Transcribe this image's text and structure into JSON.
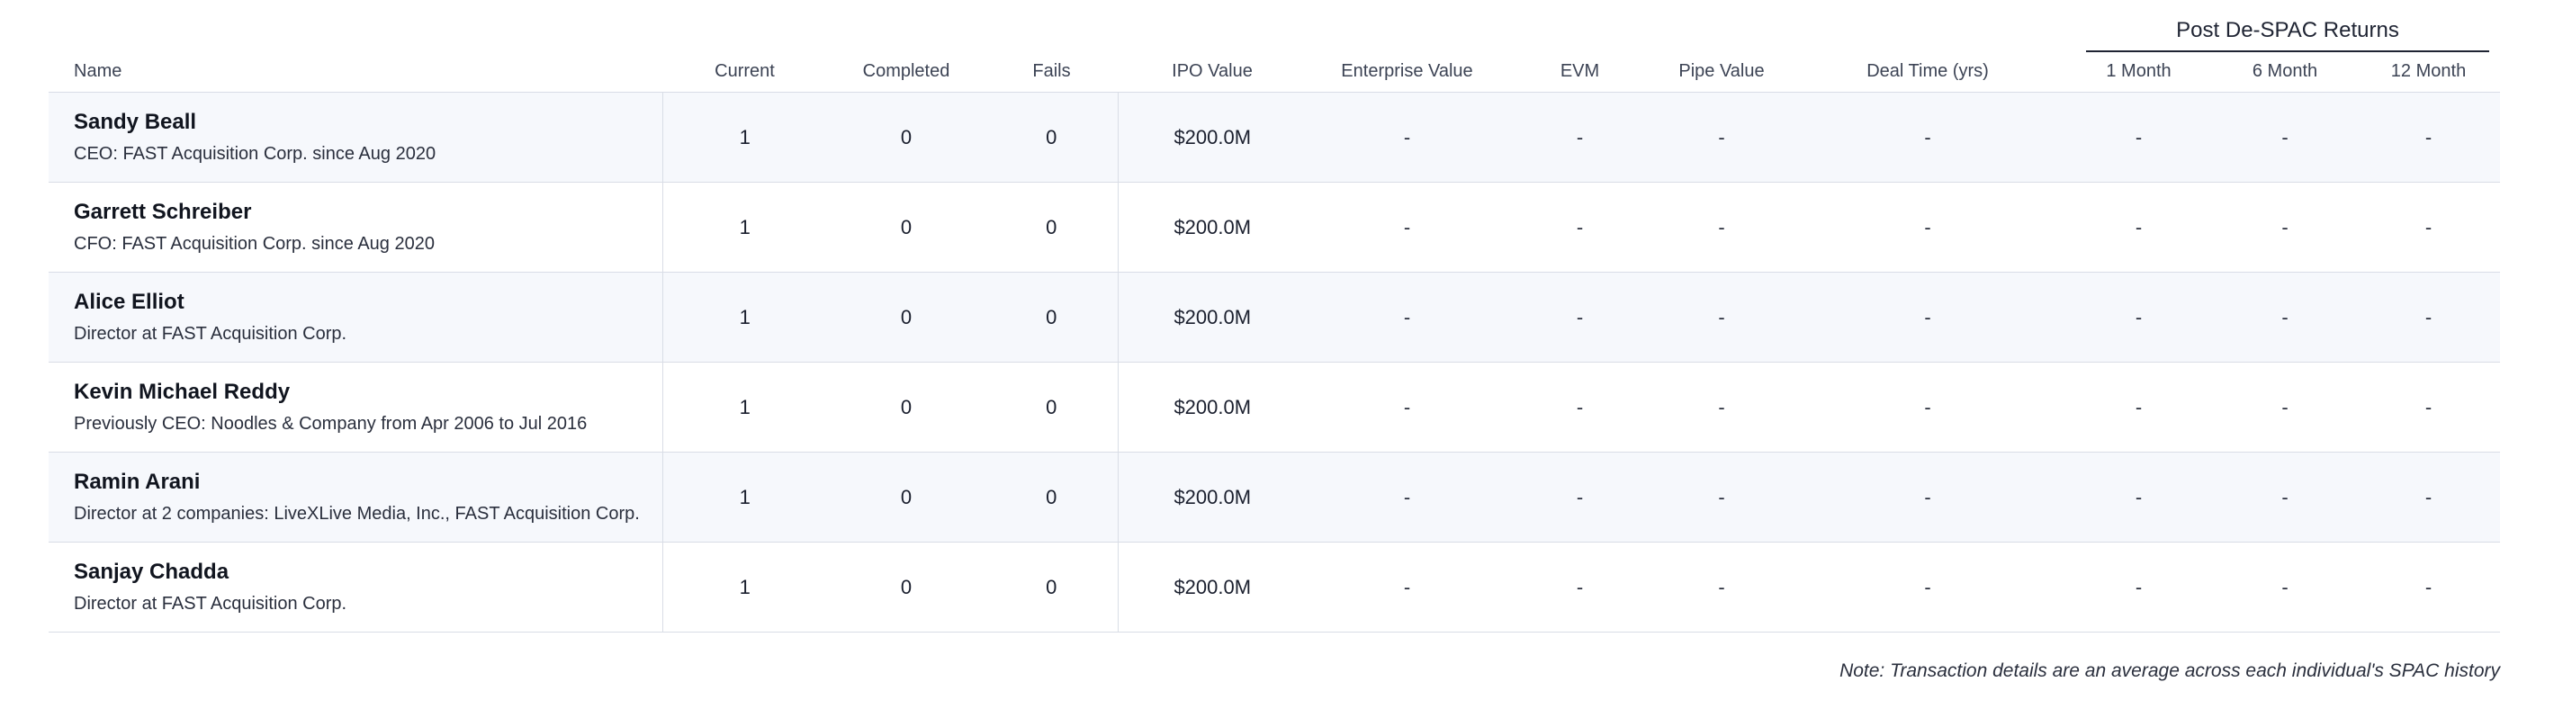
{
  "group_header": "Post De-SPAC Returns",
  "columns": {
    "name": "Name",
    "current": "Current",
    "completed": "Completed",
    "fails": "Fails",
    "ipo_value": "IPO Value",
    "enterprise_value": "Enterprise Value",
    "evm": "EVM",
    "pipe_value": "Pipe Value",
    "deal_time": "Deal Time (yrs)",
    "m1": "1 Month",
    "m6": "6 Month",
    "m12": "12 Month"
  },
  "rows": [
    {
      "name": "Sandy Beall",
      "title": "CEO: FAST Acquisition Corp. since Aug 2020",
      "current": "1",
      "completed": "0",
      "fails": "0",
      "ipo_value": "$200.0M",
      "enterprise_value": "-",
      "evm": "-",
      "pipe_value": "-",
      "deal_time": "-",
      "m1": "-",
      "m6": "-",
      "m12": "-"
    },
    {
      "name": "Garrett Schreiber",
      "title": "CFO: FAST Acquisition Corp. since Aug 2020",
      "current": "1",
      "completed": "0",
      "fails": "0",
      "ipo_value": "$200.0M",
      "enterprise_value": "-",
      "evm": "-",
      "pipe_value": "-",
      "deal_time": "-",
      "m1": "-",
      "m6": "-",
      "m12": "-"
    },
    {
      "name": "Alice Elliot",
      "title": "Director at FAST Acquisition Corp.",
      "current": "1",
      "completed": "0",
      "fails": "0",
      "ipo_value": "$200.0M",
      "enterprise_value": "-",
      "evm": "-",
      "pipe_value": "-",
      "deal_time": "-",
      "m1": "-",
      "m6": "-",
      "m12": "-"
    },
    {
      "name": "Kevin Michael Reddy",
      "title": "Previously CEO: Noodles & Company from Apr 2006 to Jul 2016",
      "current": "1",
      "completed": "0",
      "fails": "0",
      "ipo_value": "$200.0M",
      "enterprise_value": "-",
      "evm": "-",
      "pipe_value": "-",
      "deal_time": "-",
      "m1": "-",
      "m6": "-",
      "m12": "-"
    },
    {
      "name": "Ramin Arani",
      "title": "Director at 2 companies: LiveXLive Media, Inc., FAST Acquisition Corp.",
      "current": "1",
      "completed": "0",
      "fails": "0",
      "ipo_value": "$200.0M",
      "enterprise_value": "-",
      "evm": "-",
      "pipe_value": "-",
      "deal_time": "-",
      "m1": "-",
      "m6": "-",
      "m12": "-"
    },
    {
      "name": "Sanjay Chadda",
      "title": "Director at FAST Acquisition Corp.",
      "current": "1",
      "completed": "0",
      "fails": "0",
      "ipo_value": "$200.0M",
      "enterprise_value": "-",
      "evm": "-",
      "pipe_value": "-",
      "deal_time": "-",
      "m1": "-",
      "m6": "-",
      "m12": "-"
    }
  ],
  "note": "Note: Transaction details are an average across each individual's SPAC history"
}
